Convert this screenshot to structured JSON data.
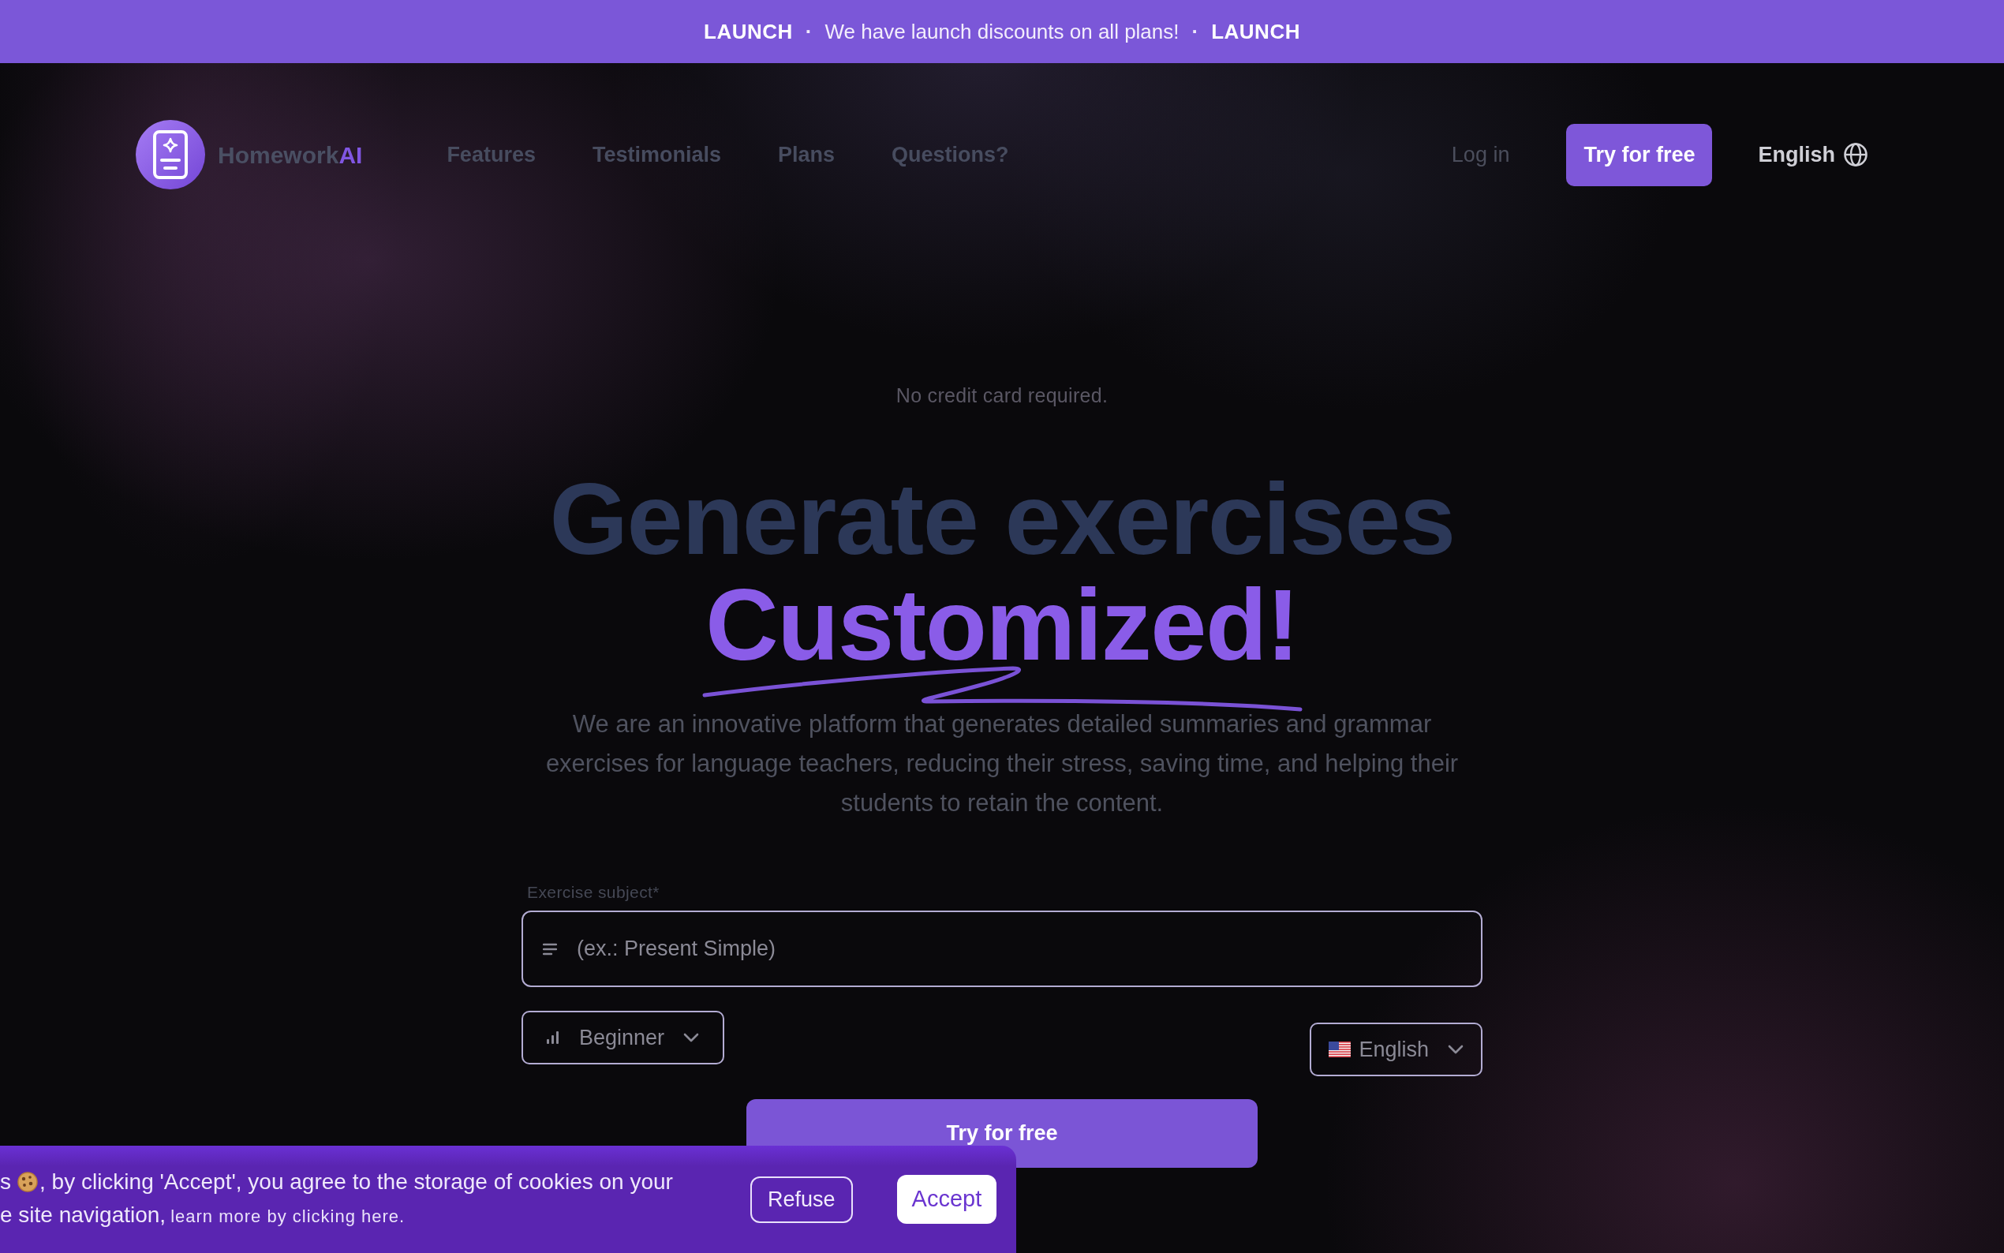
{
  "announcement_bar": {
    "items": [
      {
        "kind": "tag",
        "text": "LAUNCH"
      },
      {
        "kind": "separator",
        "text": "·"
      },
      {
        "kind": "message",
        "text": "We have launch discounts on all plans!"
      },
      {
        "kind": "separator",
        "text": "·"
      },
      {
        "kind": "tag",
        "text": "LAUNCH"
      }
    ]
  },
  "navbar": {
    "brand": {
      "name": "Homework",
      "accent": "AI"
    },
    "links": [
      "Features",
      "Testimonials",
      "Plans",
      "Questions?"
    ],
    "login": "Log in",
    "cta": "Try for free",
    "language": "English"
  },
  "hero": {
    "note": "No credit card required.",
    "title": "Generate exercises",
    "title_highlight": "Customized!",
    "description": "We are an innovative platform that generates detailed summaries and grammar exercises for language teachers, reducing their stress, saving time, and helping their students to retain the content."
  },
  "form": {
    "subject": {
      "label": "Exercise subject*",
      "placeholder": "(ex.: Present Simple)"
    },
    "level_select": {
      "value": "Beginner"
    },
    "language_select": {
      "value": "English"
    },
    "submit": "Try for free"
  },
  "cookie_banner": {
    "text_before_icon": "s",
    "text_after_icon": ", by clicking 'Accept', you agree to the storage of cookies on your",
    "second_line": "e site navigation,",
    "link": "learn more by clicking here.",
    "refuse": "Refuse",
    "accept": "Accept"
  }
}
